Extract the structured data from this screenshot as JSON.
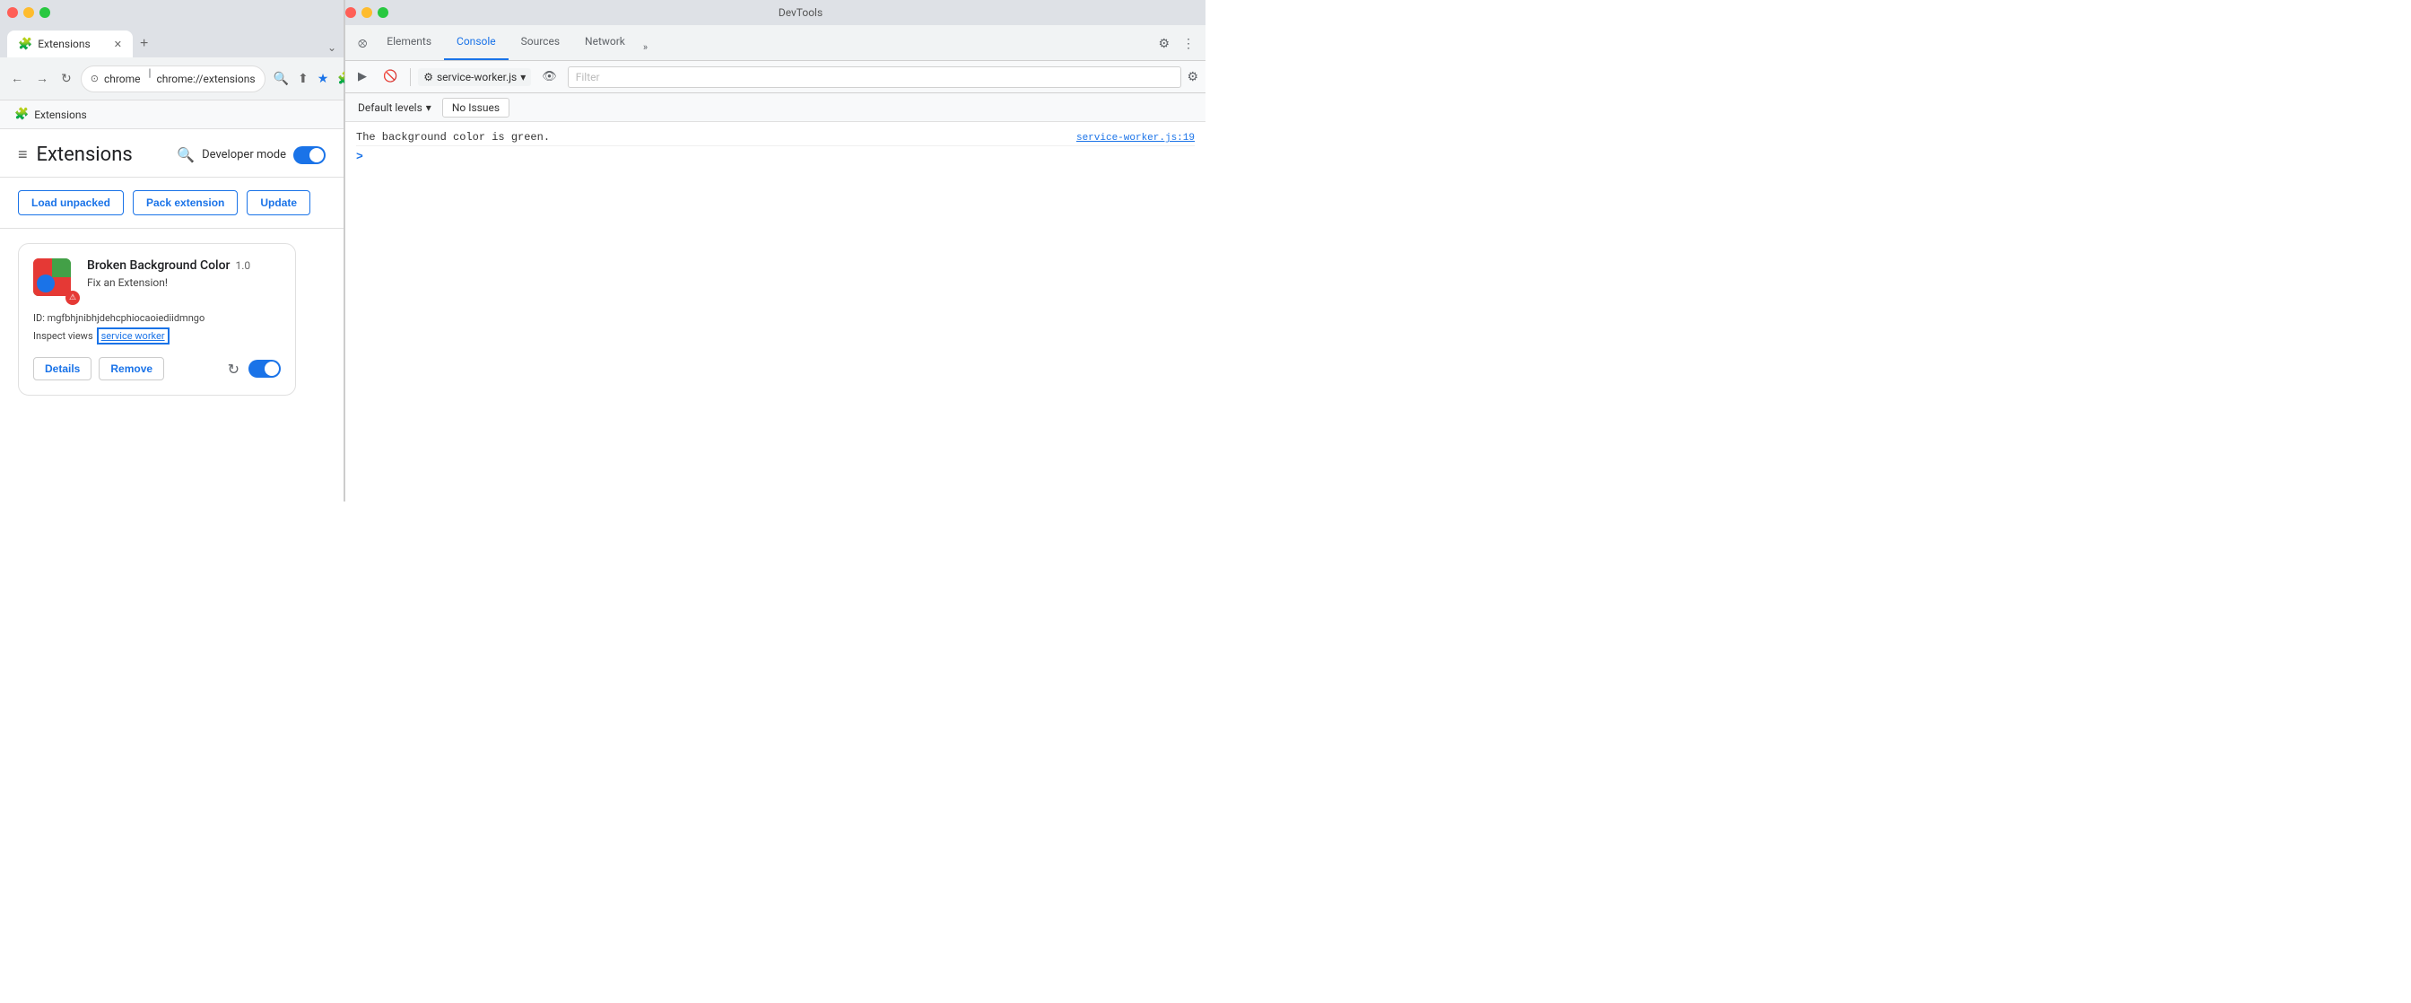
{
  "browser": {
    "tab_label": "Extensions",
    "tab_favicon": "🧩",
    "url": "chrome://extensions",
    "url_protocol": "chrome",
    "new_tab_title": "+",
    "menu_dots": "⌄"
  },
  "breadcrumb": {
    "icon": "🧩",
    "label": "Extensions"
  },
  "extensions_page": {
    "hamburger": "≡",
    "title": "Extensions",
    "search_icon": "🔍",
    "dev_mode_label": "Developer mode",
    "buttons": {
      "load_unpacked": "Load unpacked",
      "pack_extension": "Pack extension",
      "update": "Update"
    },
    "card": {
      "name": "Broken Background Color",
      "version": "1.0",
      "description": "Fix an Extension!",
      "id_label": "ID: mgfbhjnibhjdehcphiocaoiediidmngo",
      "inspect_label": "Inspect views",
      "service_worker_link": "service worker",
      "details_btn": "Details",
      "remove_btn": "Remove"
    }
  },
  "devtools": {
    "title": "DevTools",
    "tabs": {
      "cursor_icon": "⮾",
      "elements": "Elements",
      "console": "Console",
      "sources": "Sources",
      "network": "Network",
      "more": "»"
    },
    "console_toolbar": {
      "play_icon": "▶",
      "ban_icon": "🚫",
      "source_file": "service-worker.js",
      "source_dropdown": "▾",
      "eye_icon": "👁",
      "filter_placeholder": "Filter"
    },
    "levels_bar": {
      "default_levels": "Default levels",
      "dropdown_arrow": "▾",
      "no_issues": "No Issues"
    },
    "console_output": {
      "message": "The background color is green.",
      "source_link": "service-worker.js:19"
    }
  }
}
